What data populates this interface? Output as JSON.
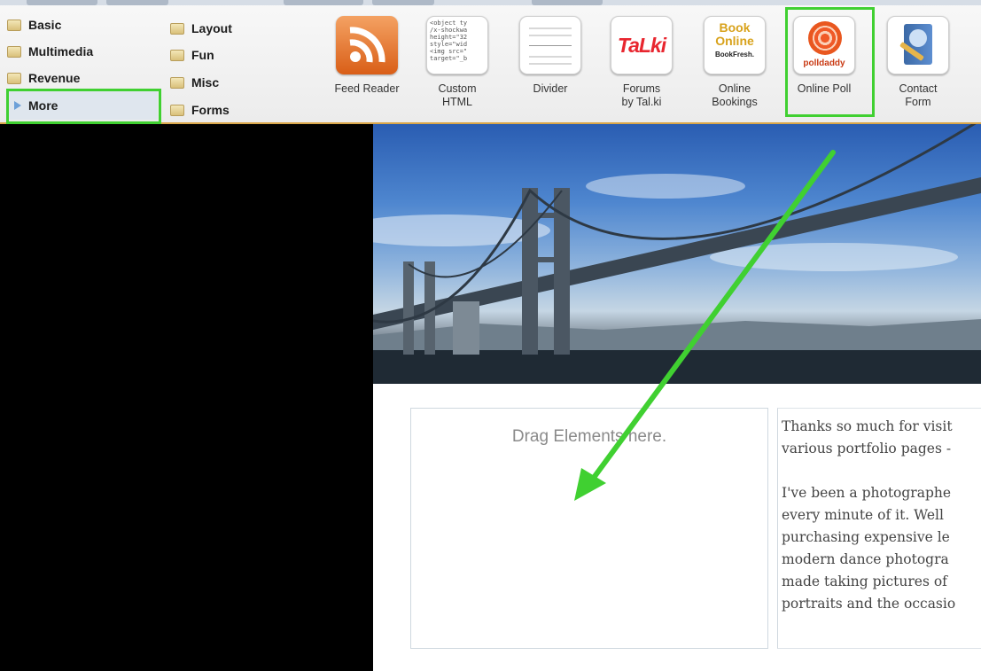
{
  "toolbar": {
    "categories_col1": [
      {
        "label": "Basic"
      },
      {
        "label": "Multimedia"
      },
      {
        "label": "Revenue"
      },
      {
        "label": "More",
        "selected": true
      }
    ],
    "categories_col2": [
      {
        "label": "Layout"
      },
      {
        "label": "Fun"
      },
      {
        "label": "Misc"
      },
      {
        "label": "Forms"
      }
    ],
    "tools": [
      {
        "label": "Feed Reader",
        "icon": "rss-feed-icon"
      },
      {
        "label": "Custom\nHTML",
        "icon": "html-code-icon",
        "icon_text": "<object ty\n/x-shockwa\nheight=\"32\nstyle=\"wid\n<img src=\"\ntarget=\"_b"
      },
      {
        "label": "Divider",
        "icon": "divider-icon"
      },
      {
        "label": "Forums\nby Tal.ki",
        "icon": "talki-logo-icon",
        "icon_text": "TaLki"
      },
      {
        "label": "Online\nBookings",
        "icon": "bookfresh-icon",
        "icon_text_1": "Book",
        "icon_text_2": "Online",
        "icon_text_3": "BookFresh."
      },
      {
        "label": "Online Poll",
        "icon": "polldaddy-icon",
        "icon_text": "polldaddy",
        "highlighted": true
      },
      {
        "label": "Contact\nForm",
        "icon": "contact-book-icon"
      }
    ]
  },
  "canvas": {
    "drop_placeholder": "Drag Elements here.",
    "text_lines": [
      "Thanks so much for visit",
      "various portfolio pages -",
      "",
      "I've been a photographe",
      "every minute of it.  Well",
      "purchasing expensive le",
      "modern dance photogra",
      "made taking pictures of",
      "portraits and the occasio"
    ]
  },
  "colors": {
    "highlight": "#40d031",
    "toolbar_border": "#d9a64a",
    "left_pane": "#000000"
  }
}
